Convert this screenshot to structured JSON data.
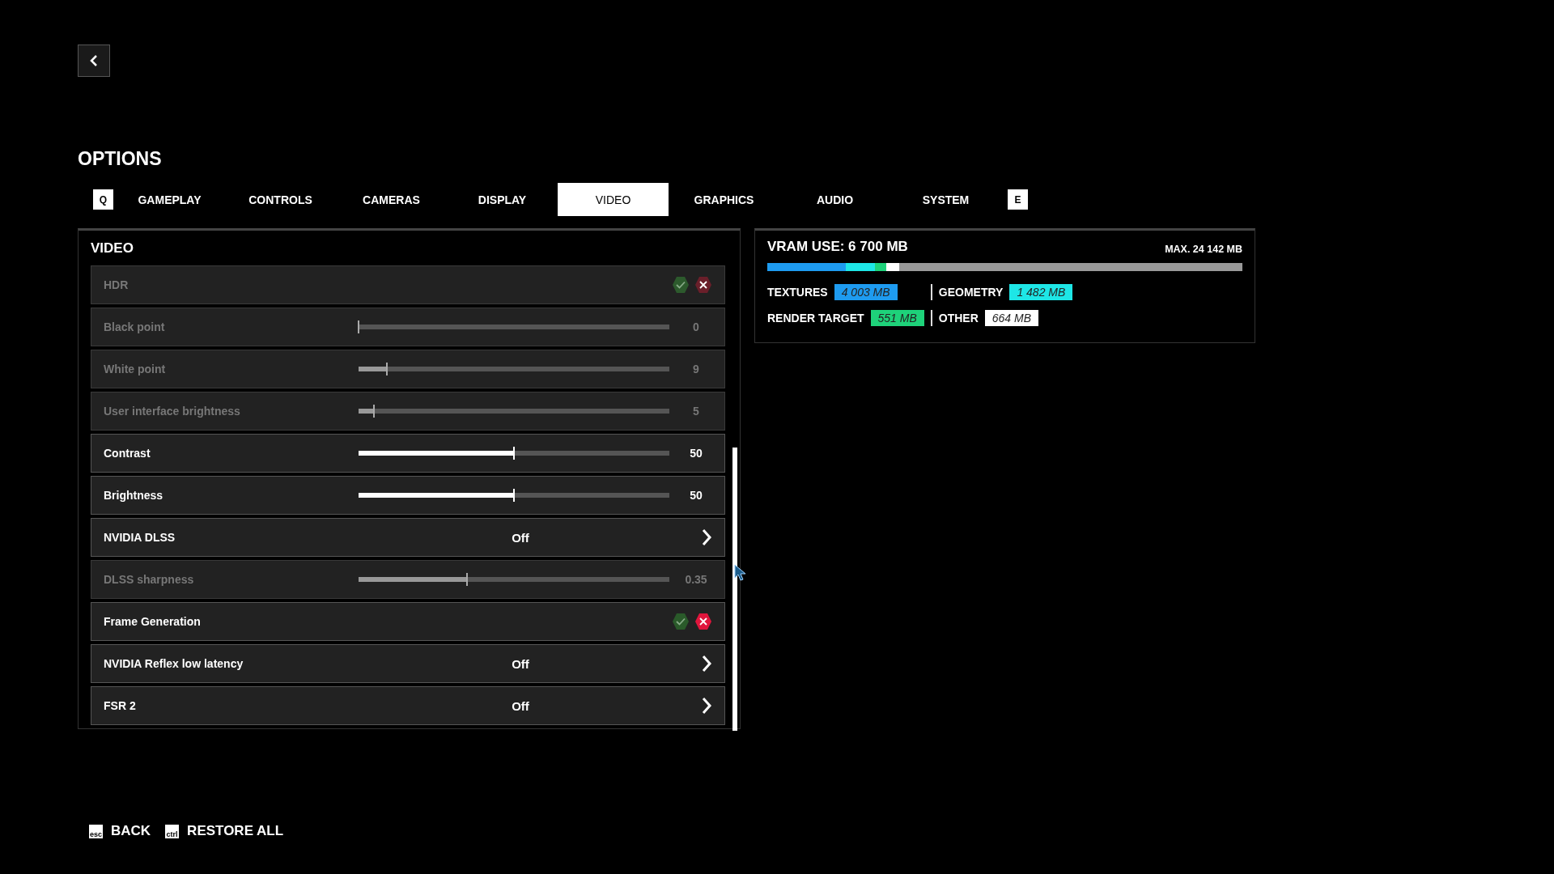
{
  "title": "OPTIONS",
  "tabs": [
    {
      "label": "Q",
      "kind": "key"
    },
    {
      "label": "GAMEPLAY",
      "kind": "tab",
      "selected": false
    },
    {
      "label": "CONTROLS",
      "kind": "tab",
      "selected": false
    },
    {
      "label": "CAMERAS",
      "kind": "tab",
      "selected": false
    },
    {
      "label": "DISPLAY",
      "kind": "tab",
      "selected": false
    },
    {
      "label": "VIDEO",
      "kind": "tab",
      "selected": true
    },
    {
      "label": "GRAPHICS",
      "kind": "tab",
      "selected": false
    },
    {
      "label": "AUDIO",
      "kind": "tab",
      "selected": false
    },
    {
      "label": "SYSTEM",
      "kind": "tab",
      "selected": false
    },
    {
      "label": "E",
      "kind": "key"
    }
  ],
  "section": {
    "title": "VIDEO",
    "rows": [
      {
        "kind": "toggle",
        "label": "HDR",
        "disabled": true,
        "on": false
      },
      {
        "kind": "slider",
        "label": "Black point",
        "disabled": true,
        "level": 0,
        "reading": "0"
      },
      {
        "kind": "slider",
        "label": "White point",
        "disabled": true,
        "level": 0.09,
        "reading": "9"
      },
      {
        "kind": "slider",
        "label": "User interface brightness",
        "disabled": true,
        "level": 0.05,
        "reading": "5"
      },
      {
        "kind": "slider",
        "label": "Contrast",
        "disabled": false,
        "level": 0.5,
        "reading": "50"
      },
      {
        "kind": "slider",
        "label": "Brightness",
        "disabled": false,
        "level": 0.5,
        "reading": "50"
      },
      {
        "kind": "select",
        "label": "NVIDIA DLSS",
        "disabled": false,
        "value": "Off"
      },
      {
        "kind": "slider",
        "label": "DLSS sharpness",
        "disabled": true,
        "level": 0.35,
        "reading": "0.35"
      },
      {
        "kind": "toggle",
        "label": "Frame Generation",
        "disabled": false,
        "on": false
      },
      {
        "kind": "select",
        "label": "NVIDIA Reflex low latency",
        "disabled": false,
        "value": "Off"
      },
      {
        "kind": "select",
        "label": "FSR 2",
        "disabled": false,
        "value": "Off"
      }
    ]
  },
  "vram": {
    "title": "VRAM USE: 6 700 MB",
    "max": "MAX. 24 142 MB",
    "parts": [
      {
        "label": "TEXTURES",
        "value": "4 003 MB",
        "color": "#1e9bf0"
      },
      {
        "label": "GEOMETRY",
        "value": "1 482 MB",
        "color": "#1ee6e6"
      },
      {
        "label": "RENDER TARGET",
        "value": "551 MB",
        "color": "#1ed27a"
      },
      {
        "label": "OTHER",
        "value": "664 MB",
        "color": "#ffffff"
      }
    ]
  },
  "footer": [
    {
      "key": "esc",
      "label": "BACK"
    },
    {
      "key": "ctrl",
      "label": "RESTORE ALL"
    }
  ]
}
